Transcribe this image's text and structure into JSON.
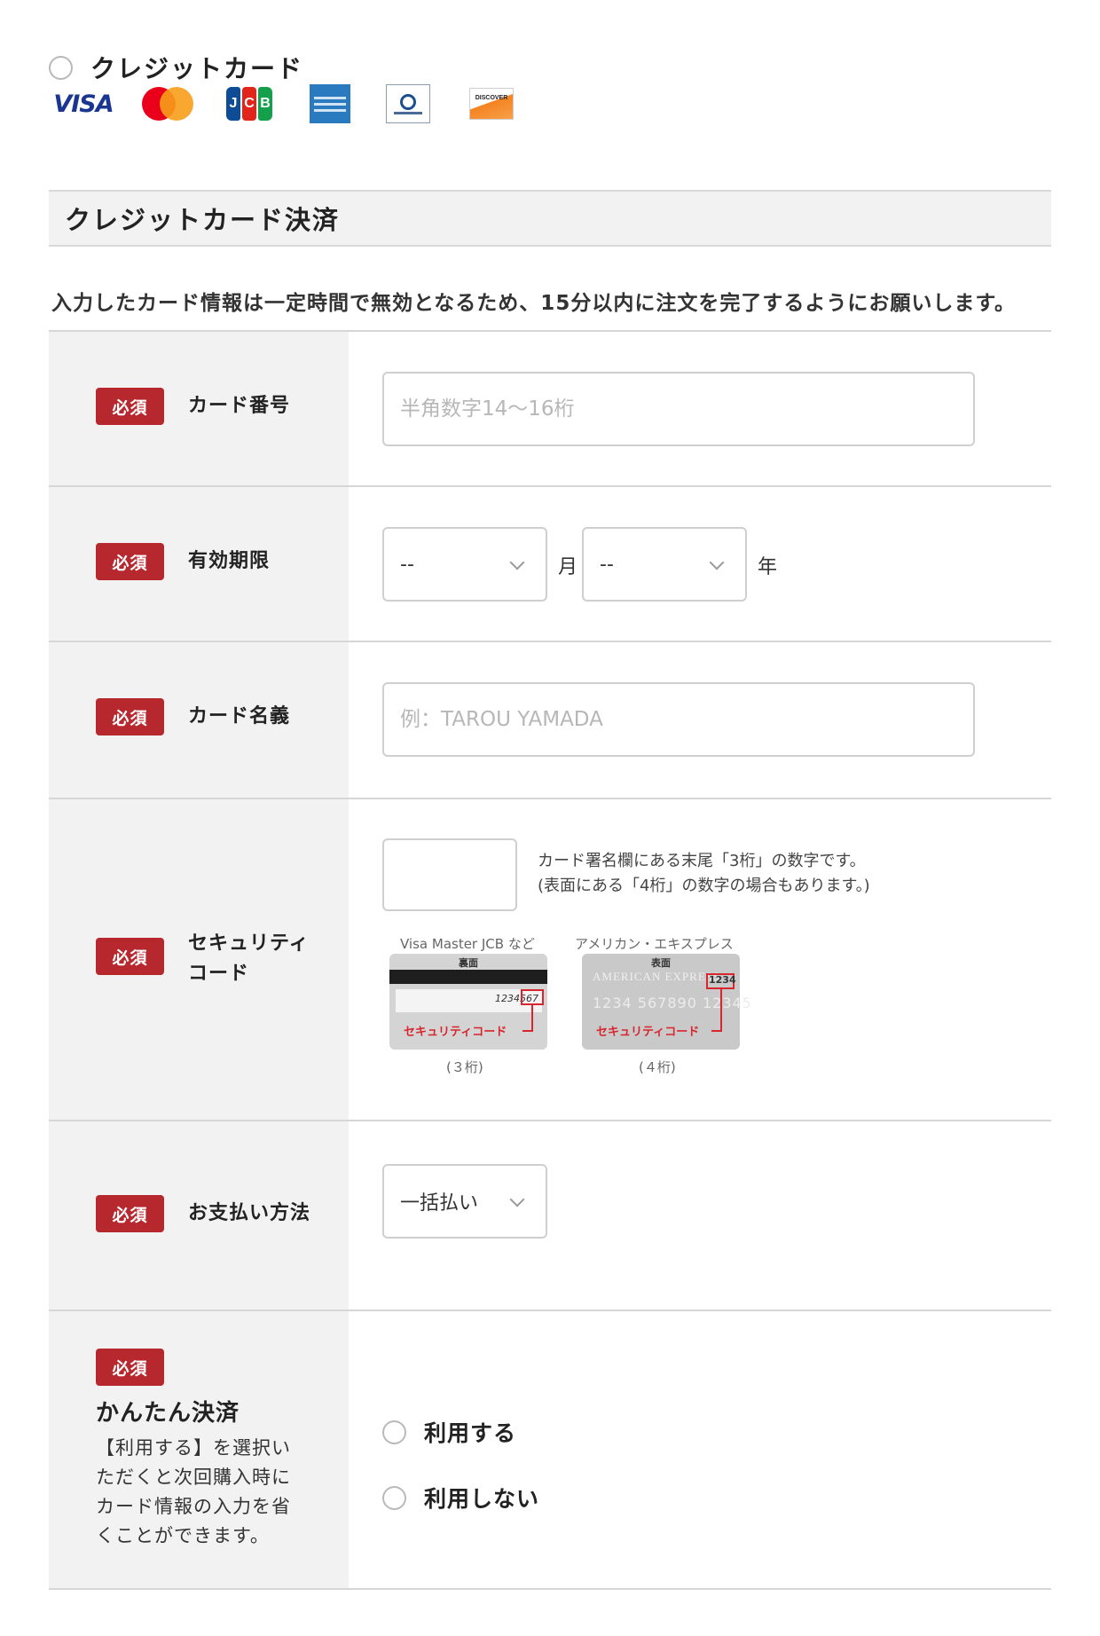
{
  "payment_option": {
    "label": "クレジットカード",
    "brands": [
      "visa-logo",
      "mastercard-logo",
      "jcb-logo",
      "amex-logo",
      "diners-club-logo",
      "discover-logo"
    ],
    "visa_text": "VISA",
    "jcb_letters": [
      "J",
      "C",
      "B"
    ],
    "discover_text": "DISCOVER"
  },
  "section": {
    "title": "クレジットカード決済",
    "notice": "入力したカード情報は一定時間で無効となるため、15分以内に注文を完了するようにお願いします。"
  },
  "required_badge": "必須",
  "card_number": {
    "label": "カード番号",
    "placeholder": "半角数字14〜16桁"
  },
  "expiry": {
    "label": "有効期限",
    "month_value": "--",
    "month_unit": "月",
    "year_value": "--",
    "year_unit": "年"
  },
  "card_name": {
    "label": "カード名義",
    "placeholder": "例：TAROU YAMADA"
  },
  "security": {
    "label_line1": "セキュリティ",
    "label_line2": "コード",
    "help_line1": "カード署名欄にある末尾「3桁」の数字です。",
    "help_line2": "(表面にある「4桁」の数字の場合もあります。)",
    "card1_caption": "Visa Master JCB など",
    "card1_side": "裏面",
    "card1_number": "1234",
    "card1_code": "567",
    "card1_digits": "(３桁)",
    "card2_caption": "アメリカン・エキスプレス",
    "card2_side": "表面",
    "card2_brand": "AMERICAN EXPRESS",
    "card2_number": "1234 567890 12345",
    "card2_code": "1234",
    "card2_digits": "(４桁)",
    "code_label": "セキュリティコード"
  },
  "payment_method": {
    "label": "お支払い方法",
    "value": "一括払い"
  },
  "easy_pay": {
    "title": "かんたん決済",
    "description": "【利用する】を選択いただくと次回購入時にカード情報の入力を省くことができます。",
    "option_use": "利用する",
    "option_not_use": "利用しない"
  }
}
